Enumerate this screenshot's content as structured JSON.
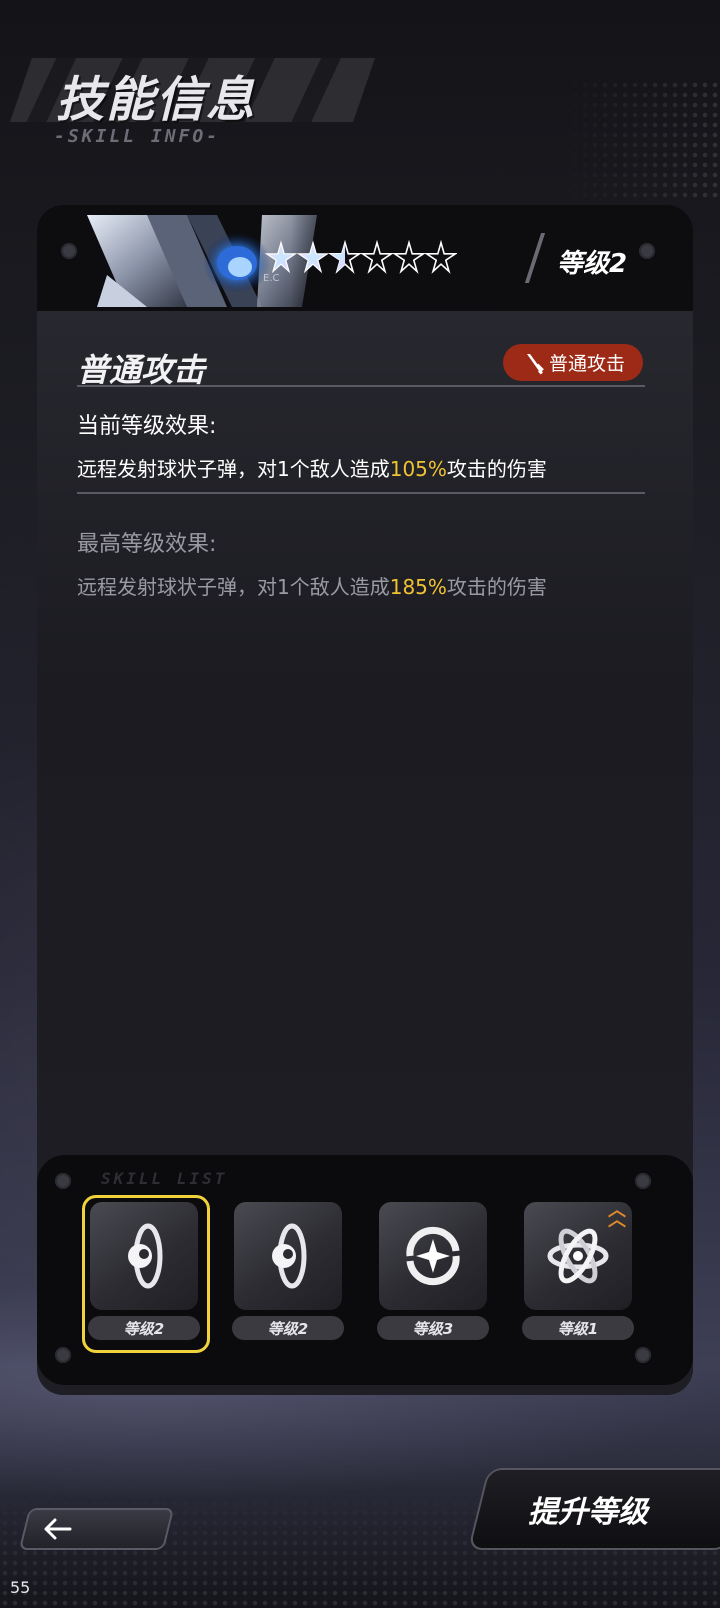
{
  "header": {
    "title": "技能信息",
    "subtitle": "-SKILL INFO-"
  },
  "skill_card": {
    "level_label": "等级2",
    "stars": {
      "filled": 2.5,
      "total": 6
    },
    "skill_name": "普通攻击",
    "type_badge": {
      "label": "普通攻击",
      "icon": "sword-icon",
      "color": "#9c2a17"
    },
    "current": {
      "label": "当前等级效果:",
      "text_before": "远程发射球状子弹，对1个敌人造成",
      "value": "105%",
      "text_after": "攻击的伤害"
    },
    "max": {
      "label": "最高等级效果:",
      "text_before": "远程发射球状子弹，对1个敌人造成",
      "value": "185%",
      "text_after": "攻击的伤害"
    }
  },
  "levels_panel": {
    "deco_text": "SKILL LIST",
    "items": [
      {
        "label": "等级2",
        "icon": "orbit-sphere-icon",
        "selected": true,
        "upgradable": false
      },
      {
        "label": "等级2",
        "icon": "orbit-sphere-icon",
        "selected": false,
        "upgradable": false
      },
      {
        "label": "等级3",
        "icon": "compass-star-icon",
        "selected": false,
        "upgradable": false
      },
      {
        "label": "等级1",
        "icon": "atom-icon",
        "selected": false,
        "upgradable": true
      }
    ]
  },
  "buttons": {
    "back_icon": "arrow-left-icon",
    "upgrade_label": "提升等级"
  },
  "fps": "55",
  "colors": {
    "highlight": "#f1c232",
    "selected_border": "#f0d23c",
    "upgrade_arrow": "#e08a2a"
  }
}
